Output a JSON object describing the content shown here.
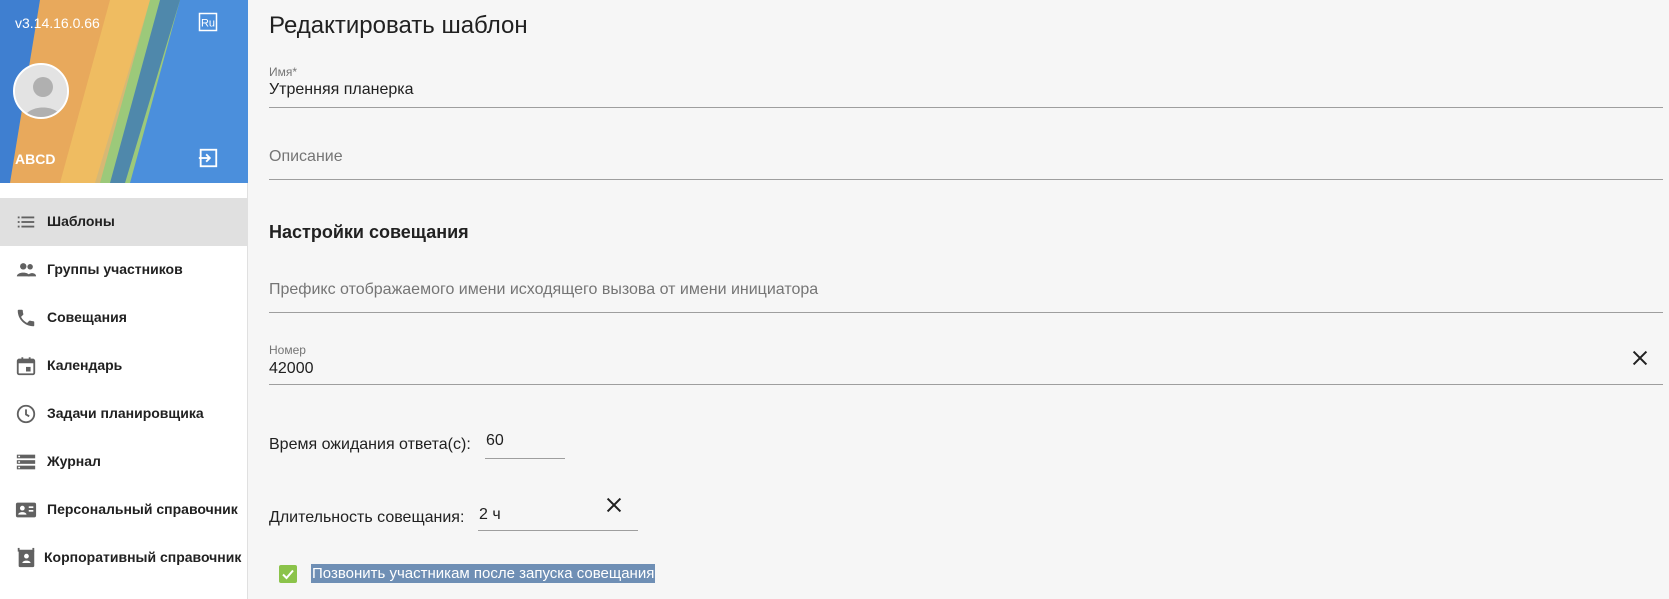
{
  "app": {
    "version": "v3.14.16.0.66",
    "language_badge": "Ru",
    "username": "ABCD",
    "colors": {
      "active_nav_bg": "#e0e0e0",
      "checkbox": "#8bc34a",
      "selection": "#6f8fb5"
    }
  },
  "sidebar": {
    "items": [
      {
        "label": "Шаблоны",
        "icon": "list-icon"
      },
      {
        "label": "Группы участников",
        "icon": "people-icon"
      },
      {
        "label": "Совещания",
        "icon": "phone-icon"
      },
      {
        "label": "Календарь",
        "icon": "calendar-icon"
      },
      {
        "label": "Задачи планировщика",
        "icon": "clock-icon"
      },
      {
        "label": "Журнал",
        "icon": "storage-icon"
      },
      {
        "label": "Персональный справочник",
        "icon": "contact-card-icon"
      },
      {
        "label": "Корпоративный справочник",
        "icon": "contacts-book-icon"
      }
    ],
    "active_index": 0
  },
  "main": {
    "title": "Редактировать шаблон",
    "name_field": {
      "label": "Имя*",
      "value": "Утренняя планерка"
    },
    "description_field": {
      "placeholder": "Описание"
    },
    "section_title": "Настройки совещания",
    "prefix_field": {
      "placeholder": "Префикс отображаемого имени исходящего вызова от имени инициатора"
    },
    "number_field": {
      "label": "Номер",
      "value": "42000"
    },
    "wait_time": {
      "label": "Время ожидания ответа(с):",
      "value": "60"
    },
    "duration": {
      "label": "Длительность совещания:",
      "value": "2 ч"
    },
    "call_checkbox": {
      "label": "Позвонить участникам после запуска совещания",
      "checked": true
    }
  }
}
